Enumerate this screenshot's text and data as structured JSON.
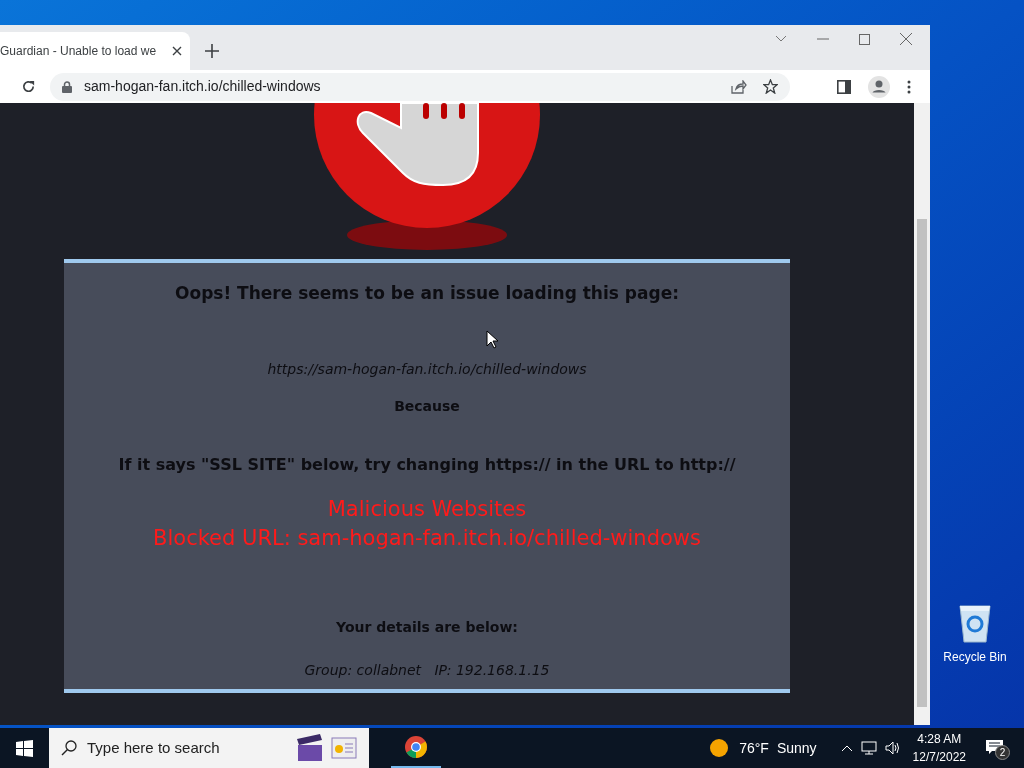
{
  "browser": {
    "tabs": [
      {
        "title": "Guardian - Unable to load we",
        "selected": true
      }
    ],
    "address": "sam-hogan-fan.itch.io/chilled-windows"
  },
  "page": {
    "heading": "Oops! There seems to be an issue loading this page:",
    "url": "https://sam-hogan-fan.itch.io/chilled-windows",
    "because": "Because",
    "hint": "If it says \"SSL SITE\" below, try changing https:// in the URL to http://",
    "block_lines": [
      "Malicious Websites",
      "Blocked URL: sam-hogan-fan.itch.io/chilled-windows"
    ],
    "details_heading": "Your details are below:",
    "details": "Group: collabnet   IP: 192.168.1.15"
  },
  "desktop_icons": [
    {
      "label": "Recycle Bin"
    }
  ],
  "taskbar": {
    "search_placeholder": "Type here to search",
    "weather": {
      "temp": "76°F",
      "condition": "Sunny"
    },
    "time": "4:28 AM",
    "date": "12/7/2022",
    "notifications": "2"
  }
}
